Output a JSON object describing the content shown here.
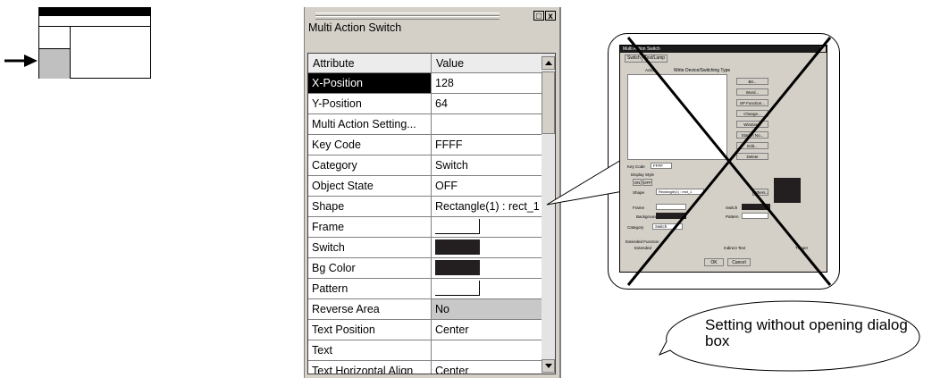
{
  "panel": {
    "title": "Multi Action Switch",
    "columns": {
      "attribute": "Attribute",
      "value": "Value"
    },
    "rows": [
      {
        "attribute": "X-Position",
        "value": "128"
      },
      {
        "attribute": "Y-Position",
        "value": "64"
      },
      {
        "attribute": "Multi Action Setting...",
        "value": ""
      },
      {
        "attribute": "Key Code",
        "value": "FFFF"
      },
      {
        "attribute": "Category",
        "value": "Switch"
      },
      {
        "attribute": "Object State",
        "value": "OFF"
      },
      {
        "attribute": "Shape",
        "value": "Rectangle(1) : rect_1"
      },
      {
        "attribute": "Frame",
        "value": ""
      },
      {
        "attribute": "Switch",
        "value": ""
      },
      {
        "attribute": "Bg Color",
        "value": ""
      },
      {
        "attribute": "Pattern",
        "value": ""
      },
      {
        "attribute": "Reverse Area",
        "value": "No"
      },
      {
        "attribute": "Text Position",
        "value": "Center"
      },
      {
        "attribute": "Text",
        "value": ""
      },
      {
        "attribute": "Text Horizontal Align",
        "value": "Center"
      }
    ],
    "selected_row": "X-Position",
    "swatch_colors": {
      "frame": "#ffffff",
      "switch": "#231f20",
      "bg_color": "#231f20",
      "pattern": "#ffffff"
    },
    "window_buttons": {
      "restore": "□",
      "close": "x"
    }
  },
  "dialog_thumbnail": {
    "title": "Multi Action Switch",
    "tabs": [
      "Switch",
      "Text/Lamp"
    ],
    "list_header_action": "Action",
    "list_header_type": "Write Device/Switching Type",
    "buttons": [
      "Bit...",
      "Word...",
      "SP Function...",
      "Change...",
      "Window...",
      "Station No...",
      "Edit...",
      "Delete"
    ],
    "key_code_label": "Key Code",
    "key_code_value": "FFFF",
    "display_style_label": "Display Style",
    "state_buttons": [
      "ON",
      "OFF"
    ],
    "shape_label": "Shape",
    "shape_value": "Rectangle(1) : rect_1",
    "other_button": "Others...",
    "frame_label": "Frame",
    "switch_label": "Switch",
    "background_label": "Background",
    "pattern_label": "Pattern",
    "category_label": "Category",
    "category_value": "Switch",
    "extended_function_label": "Extended Function",
    "extended_label": "Extended",
    "indirect_text_label": "Indirect Text",
    "trigger_label": "Trigger",
    "ok_label": "OK",
    "cancel_label": "Cancel"
  },
  "bubble": {
    "text": "Setting without opening dialog box"
  },
  "colors": {
    "panel_bg": "#d4d0c8",
    "dark_swatch": "#231f20",
    "selected_bg": "#000000"
  }
}
